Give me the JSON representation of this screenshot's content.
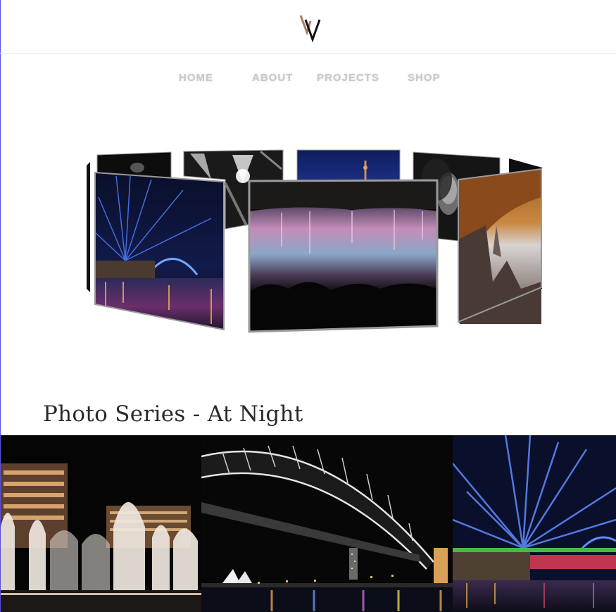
{
  "site": {
    "logo_icon": "vv-monogram-logo-icon",
    "accent_color": "#a87d62"
  },
  "nav": {
    "items": [
      {
        "label": "HOME"
      },
      {
        "label": "ABOUT"
      },
      {
        "label": "PROJECTS"
      },
      {
        "label": "SHOP"
      }
    ]
  },
  "carousel": {
    "front_image": "niagara-falls-night",
    "images": [
      "sydney-harbour-light-show",
      "black-white-architecture",
      "niagara-falls-night",
      "tower-night-sky",
      "black-white-portrait",
      "desert-rock-arch"
    ]
  },
  "series": {
    "title": "Photo Series - At Night"
  },
  "gallery": {
    "photos": [
      "las-vegas-fountains-night",
      "sydney-harbour-bridge-night",
      "sydney-light-beams-night"
    ]
  }
}
